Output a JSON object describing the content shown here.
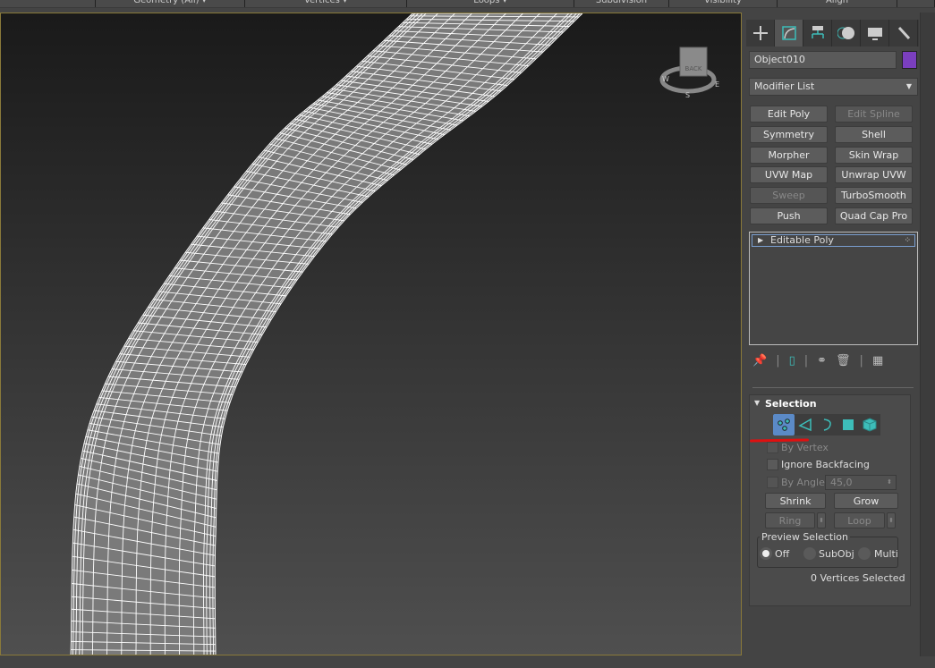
{
  "toolbar": {
    "items": [
      "",
      "Geometry (All) ▾",
      "Vertices ▾",
      "Loops ▾",
      "Subdivision",
      "Visibility",
      "Align",
      ""
    ]
  },
  "viewcube": {
    "face_label": "BACK",
    "compass": [
      "S",
      "W",
      "E"
    ]
  },
  "command_panel": {
    "tabs": [
      {
        "icon": "create-icon"
      },
      {
        "icon": "modify-icon",
        "active": true
      },
      {
        "icon": "hierarchy-icon"
      },
      {
        "icon": "motion-icon"
      },
      {
        "icon": "display-icon"
      },
      {
        "icon": "utilities-icon"
      }
    ],
    "object_name": "Object010",
    "object_color": "#7b3fbf",
    "modifier_list": "Modifier List",
    "modifier_buttons": [
      {
        "label": "Edit Poly",
        "enabled": true
      },
      {
        "label": "Edit Spline",
        "enabled": false
      },
      {
        "label": "Symmetry",
        "enabled": true
      },
      {
        "label": "Shell",
        "enabled": true
      },
      {
        "label": "Morpher",
        "enabled": true
      },
      {
        "label": "Skin Wrap",
        "enabled": true
      },
      {
        "label": "UVW Map",
        "enabled": true
      },
      {
        "label": "Unwrap UVW",
        "enabled": true
      },
      {
        "label": "Sweep",
        "enabled": false
      },
      {
        "label": "TurboSmooth",
        "enabled": true
      },
      {
        "label": "Push",
        "enabled": true
      },
      {
        "label": "Quad Cap Pro",
        "enabled": true
      }
    ],
    "stack": [
      {
        "label": "Editable Poly"
      }
    ]
  },
  "selection": {
    "title": "Selection",
    "subobject_modes": [
      "vertex",
      "edge",
      "border",
      "polygon",
      "element"
    ],
    "active_mode": "vertex",
    "by_vertex": "By Vertex",
    "ignore_backfacing": "Ignore Backfacing",
    "by_angle": "By Angle:",
    "angle_value": "45,0",
    "shrink": "Shrink",
    "grow": "Grow",
    "ring": "Ring",
    "loop": "Loop",
    "preview_title": "Preview Selection",
    "preview_options": [
      "Off",
      "SubObj",
      "Multi"
    ],
    "preview_selected": "Off",
    "status": "0 Vertices Selected"
  },
  "colors": {
    "accent": "#3dbdb9",
    "annotation": "#e01010",
    "active_mode_bg": "#5b8ac7"
  }
}
